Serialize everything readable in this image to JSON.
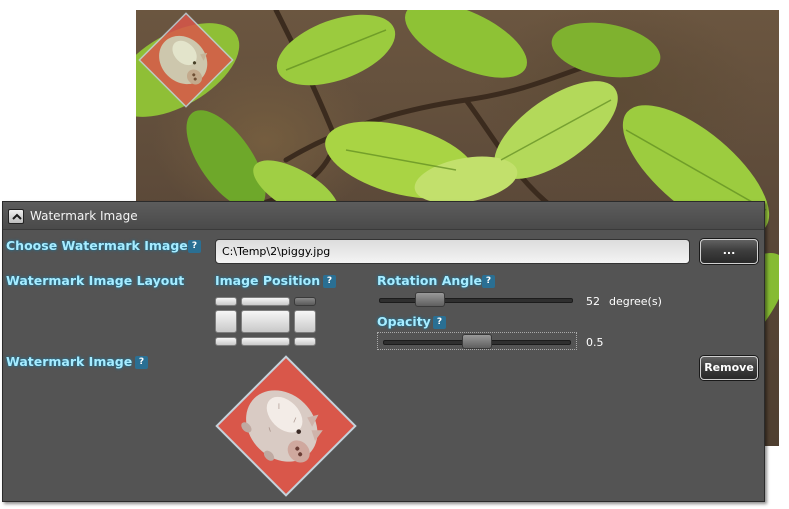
{
  "panel": {
    "title": "Watermark Image",
    "collapse_icon": "chevron-up-icon"
  },
  "choose": {
    "label": "Choose Watermark Image",
    "help": "?",
    "path_value": "C:\\Temp\\2\\piggy.jpg",
    "browse_label": "..."
  },
  "layout": {
    "label": "Watermark Image Layout",
    "position_label": "Image Position",
    "position_help": "?",
    "selected_position": "top-right",
    "rotation_label": "Rotation Angle",
    "rotation_help": "?",
    "rotation_value": "52",
    "rotation_unit": "degree(s)",
    "rotation_numeric": 52,
    "opacity_label": "Opacity",
    "opacity_help": "?",
    "opacity_value": "0.5",
    "opacity_numeric": 0.5
  },
  "image": {
    "label": "Watermark Image",
    "help": "?",
    "remove_label": "Remove"
  },
  "colors": {
    "panel_bg": "#545454",
    "label_glow": "#a8ecff",
    "help_badge": "#2a6f93",
    "watermark_red": "#d9574a"
  }
}
